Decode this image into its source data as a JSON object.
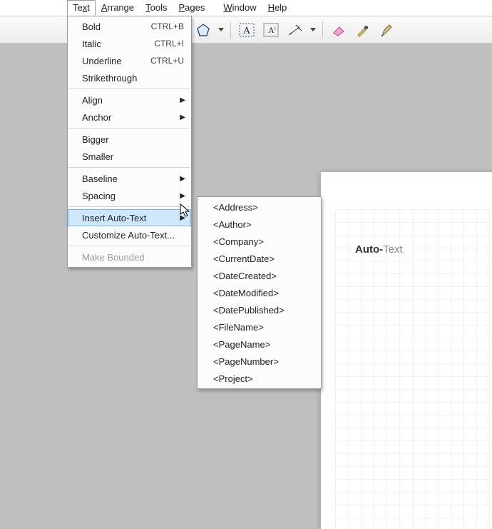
{
  "menubar": {
    "items": [
      {
        "label": "Text",
        "mn_index": 2
      },
      {
        "label": "Arrange",
        "mn_index": 0
      },
      {
        "label": "Tools",
        "mn_index": 0
      },
      {
        "label": "Pages",
        "mn_index": 0
      },
      {
        "label": "Window",
        "mn_index": 0
      },
      {
        "label": "Help",
        "mn_index": 0
      }
    ],
    "open_index": 0
  },
  "text_menu": {
    "groups": [
      [
        {
          "label": "Bold",
          "accel": "CTRL+B"
        },
        {
          "label": "Italic",
          "accel": "CTRL+I"
        },
        {
          "label": "Underline",
          "accel": "CTRL+U"
        },
        {
          "label": "Strikethrough"
        }
      ],
      [
        {
          "label": "Align",
          "submenu": true
        },
        {
          "label": "Anchor",
          "submenu": true
        }
      ],
      [
        {
          "label": "Bigger"
        },
        {
          "label": "Smaller"
        }
      ],
      [
        {
          "label": "Baseline",
          "submenu": true
        },
        {
          "label": "Spacing",
          "submenu": true
        }
      ],
      [
        {
          "label": "Insert Auto-Text",
          "submenu": true,
          "highlight": true
        },
        {
          "label": "Customize Auto-Text..."
        }
      ],
      [
        {
          "label": "Make Bounded",
          "disabled": true
        }
      ]
    ]
  },
  "auto_text_submenu": {
    "items": [
      "<Address>",
      "<Author>",
      "<Company>",
      "<CurrentDate>",
      "<DateCreated>",
      "<DateModified>",
      "<DatePublished>",
      "<FileName>",
      "<PageName>",
      "<PageNumber>",
      "<Project>"
    ]
  },
  "toolbar": {
    "icons": [
      "polygon-tool",
      "text-frame-tool",
      "text-label-tool",
      "dimension-tool",
      "eraser-tool",
      "eyedropper-tool",
      "pen-tool"
    ]
  },
  "page": {
    "label_prefix": "Auto-",
    "label_rest": "Text"
  }
}
